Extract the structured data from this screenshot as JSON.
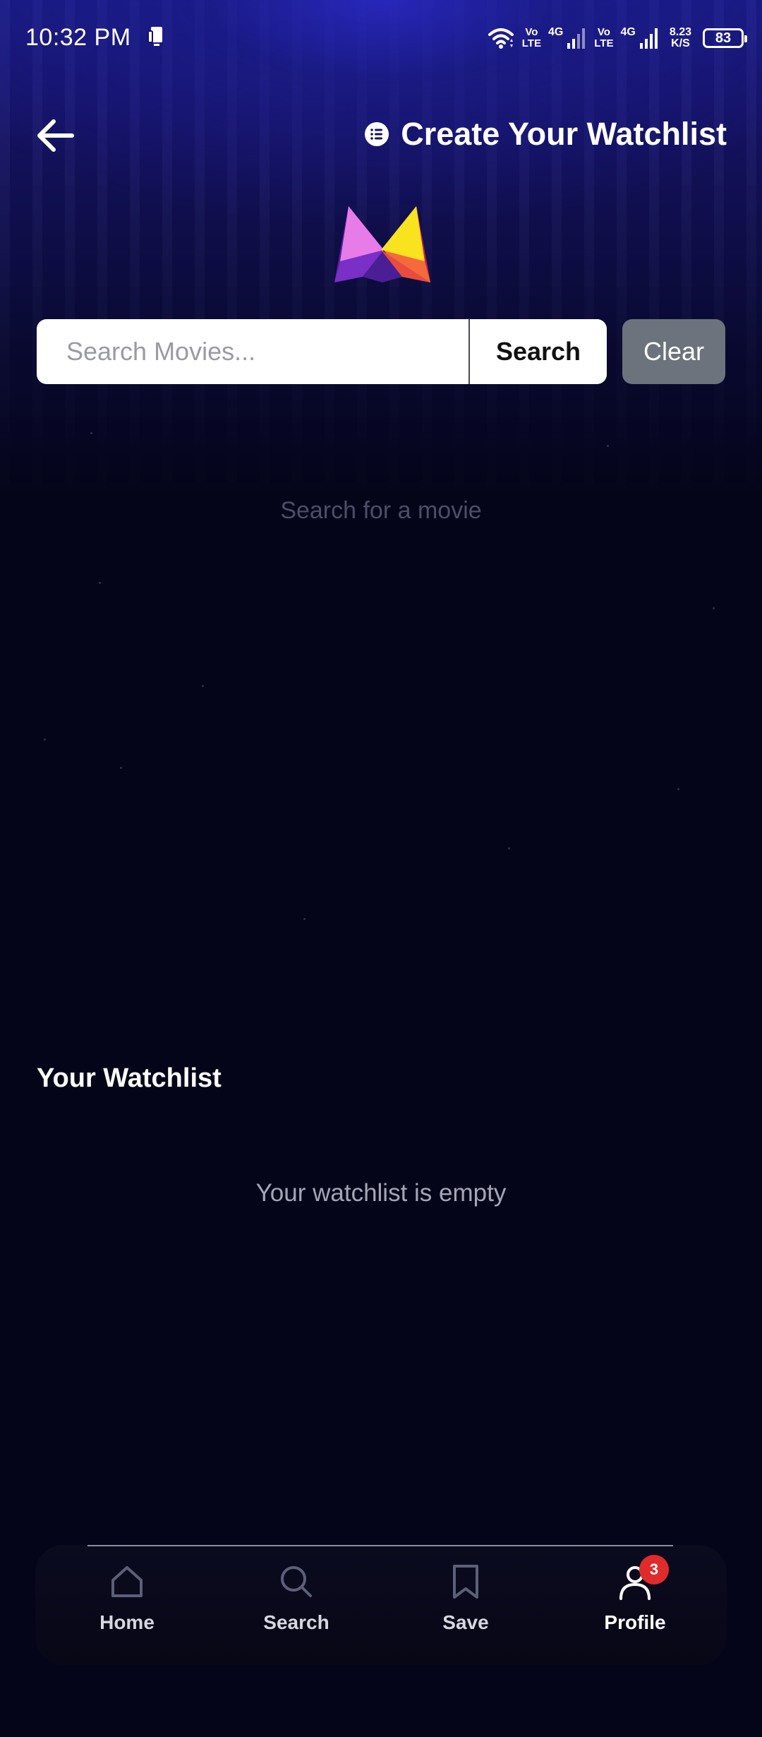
{
  "status_bar": {
    "time": "10:32 PM",
    "volte1_top": "Vo",
    "volte1_bottom": "LTE",
    "net1": "4G",
    "volte2_top": "Vo",
    "volte2_bottom": "LTE",
    "net2": "4G",
    "speed_value": "8.23",
    "speed_unit": "K/S",
    "battery": "83"
  },
  "header": {
    "title": "Create Your Watchlist"
  },
  "search": {
    "placeholder": "Search Movies...",
    "search_label": "Search",
    "clear_label": "Clear",
    "hint": "Search for a movie"
  },
  "watchlist": {
    "title": "Your Watchlist",
    "empty_text": "Your watchlist is empty"
  },
  "bottom_nav": {
    "items": [
      {
        "label": "Home",
        "icon": "home-icon"
      },
      {
        "label": "Search",
        "icon": "search-icon"
      },
      {
        "label": "Save",
        "icon": "bookmark-icon"
      },
      {
        "label": "Profile",
        "icon": "profile-icon",
        "badge": "3",
        "active": true
      }
    ]
  },
  "colors": {
    "background": "#05051a",
    "header_glow": "#1b1b8a",
    "clear_button": "#6c737c",
    "badge": "#e02b2b"
  }
}
